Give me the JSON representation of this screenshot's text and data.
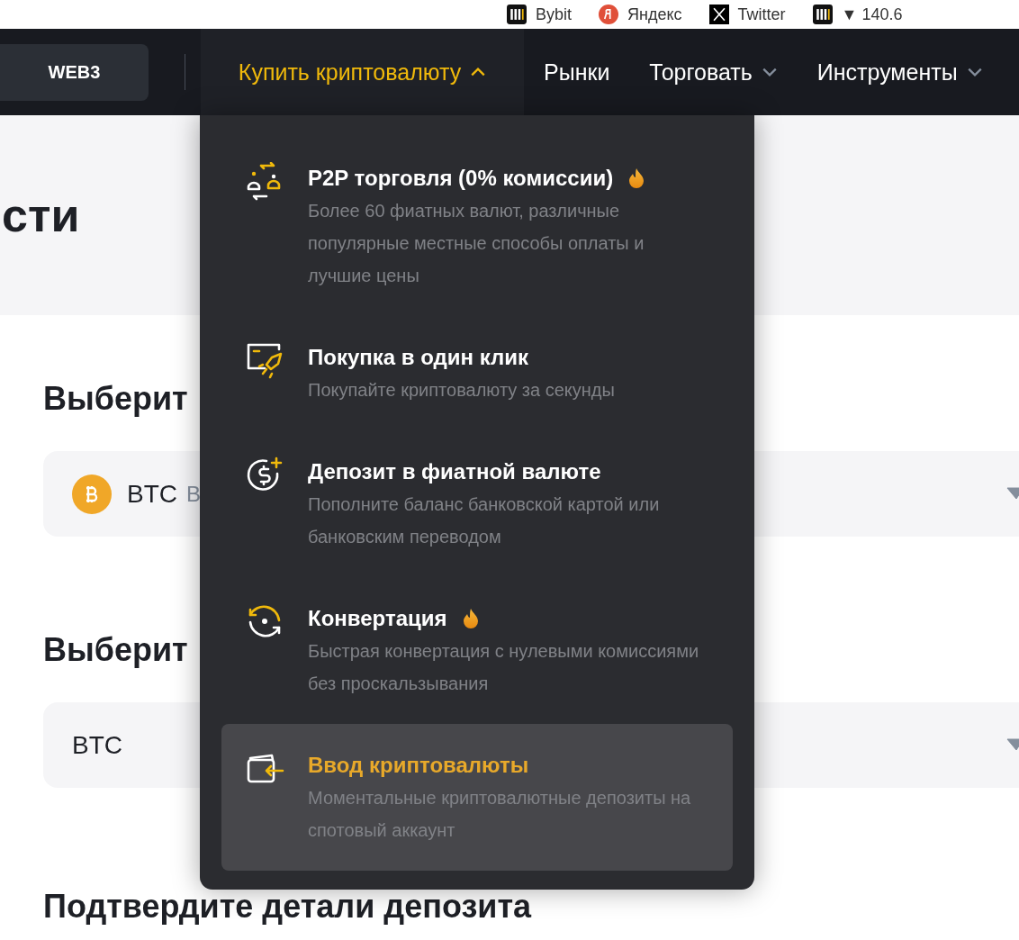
{
  "bookmarks": [
    {
      "label": "Bybit",
      "kind": "bars"
    },
    {
      "label": "Яндекс",
      "kind": "round"
    },
    {
      "label": "Twitter",
      "kind": "x"
    },
    {
      "label": "▼ 140.6",
      "kind": "bars"
    }
  ],
  "nav": {
    "web3": "WEB3",
    "items": [
      {
        "label": "Купить криптовалюту",
        "selected": true,
        "dropdown": true
      },
      {
        "label": "Рынки",
        "selected": false,
        "dropdown": false
      },
      {
        "label": "Торговать",
        "selected": false,
        "dropdown": true
      },
      {
        "label": "Инструменты",
        "selected": false,
        "dropdown": true
      }
    ]
  },
  "hero": {
    "title": "сти"
  },
  "sections": [
    {
      "heading": "Выберит",
      "field": {
        "value": "BTC",
        "coin_icon": true,
        "hint": "B"
      }
    },
    {
      "heading": "Выберит",
      "field": {
        "value": "BTC",
        "coin_icon": false
      }
    },
    {
      "heading": "Подтвердите детали депозита"
    }
  ],
  "menu": [
    {
      "kind": "p2p",
      "title": "P2P торговля (0% комиссии)",
      "hot": true,
      "description": "Более 60 фиатных валют, различные популярные местные способы оплаты и лучшие цены",
      "selected": false
    },
    {
      "kind": "rocket",
      "title": "Покупка в один клик",
      "hot": false,
      "description": "Покупайте криптовалюту за секунды",
      "selected": false
    },
    {
      "kind": "dollar",
      "title": "Депозит в фиатной валюте",
      "hot": false,
      "description": "Пополните баланс банковской картой или банковским переводом",
      "selected": false
    },
    {
      "kind": "convert",
      "title": "Конвертация",
      "hot": true,
      "description": "Быстрая конвертация с нулевыми комиссиями без проскальзывания",
      "selected": false
    },
    {
      "kind": "wallet",
      "title": "Ввод криптовалюты",
      "hot": false,
      "description": "Моментальные криптовалютные депозиты на спотовый аккаунт",
      "selected": true
    }
  ]
}
